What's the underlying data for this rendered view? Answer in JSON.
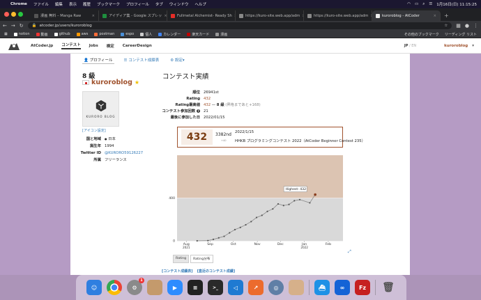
{
  "menubar": {
    "app": "Chrome",
    "items": [
      "ファイル",
      "編集",
      "表示",
      "履歴",
      "ブックマーク",
      "プロフィール",
      "タブ",
      "ウィンドウ",
      "ヘルプ"
    ],
    "datetime": "1月16日(日) 11:15:25"
  },
  "tabs": [
    {
      "title": "漫画 無料 – Manga Raw",
      "color": "#555"
    },
    {
      "title": "アイディア集 - Google スプレッ",
      "color": "#1e8e3e"
    },
    {
      "title": "Fullmetal Alchemist- Ready Sh",
      "color": "#e52d27"
    },
    {
      "title": "https://kuro-site.web.app/adm",
      "color": "#888"
    },
    {
      "title": "https://kuro-site.web.app/adm",
      "color": "#888"
    },
    {
      "title": "kuroroblog - AtCoder",
      "color": "#eee"
    }
  ],
  "address": {
    "url": "atcoder.jp/users/kuroroblog"
  },
  "bookmarks": [
    "notion",
    "動画",
    "github",
    "aws",
    "postman",
    "espo",
    "個人",
    "カレンダー",
    "楽天カード",
    "漫画"
  ],
  "bookmarks_right": [
    "その他のブックマーク",
    "リーディング リスト"
  ],
  "bookmark_colors": [
    "#fff",
    "#e33",
    "#fff",
    "#f90",
    "#ff6c37",
    "#4a90d9",
    "#ccc",
    "#4285f4",
    "#bf0000",
    "#999"
  ],
  "atcoder_nav": {
    "items": [
      "AtCoder.jp",
      "コンテスト",
      "Jobs",
      "検定",
      "CareerDesign"
    ],
    "lang_jp": "JP",
    "lang_en": "EN",
    "user": "kuroroblog"
  },
  "subnav": {
    "profile": "プロフィール",
    "history": "コンテスト成績表",
    "settings": "設定"
  },
  "user": {
    "kyu": "8 級",
    "name": "kuroroblog",
    "avatar_label": "KURORO BLOG",
    "icon_settings": "[アイコン設定]",
    "profile": [
      {
        "key": "国と地域",
        "value": "日本"
      },
      {
        "key": "誕生年",
        "value": "1994"
      },
      {
        "key": "Twitter ID",
        "value": "@KURORO59126227"
      },
      {
        "key": "所属",
        "value": "フリーランス"
      }
    ]
  },
  "contest": {
    "title": "コンテスト実績",
    "rank_label": "順位",
    "rank": "26941st",
    "rating_label": "Rating",
    "rating": "432",
    "max_label": "Rating最高値",
    "max": "432",
    "max_sep": " — ",
    "max_kyu": "8 級",
    "max_note": " (昇格まであと+168)",
    "count_label": "コンテスト参加回数",
    "count": "21",
    "last_label": "最後に参加した日",
    "last": "2022/01/15",
    "qmark": "?"
  },
  "latest": {
    "rating": "432",
    "rank": "3382nd",
    "delta": "+40",
    "date": "2022/1/15",
    "name": "HHKB プログラミングコンテスト 2022（AtCoder Beginner Contest 235）"
  },
  "buttons": {
    "rating": "Rating",
    "dist": "Rating分布"
  },
  "links": {
    "history": "[コンテスト成績表]",
    "recent": "[直近のコンテスト成績]"
  },
  "chart_data": {
    "type": "line",
    "x": [
      "2021-08-15",
      "2021-08-29",
      "2021-09-05",
      "2021-09-12",
      "2021-09-19",
      "2021-09-26",
      "2021-10-03",
      "2021-10-10",
      "2021-10-17",
      "2021-10-24",
      "2021-10-31",
      "2021-11-07",
      "2021-11-14",
      "2021-11-21",
      "2021-11-28",
      "2021-12-05",
      "2021-12-12",
      "2021-12-19",
      "2021-12-26",
      "2022-01-08",
      "2022-01-15"
    ],
    "y": [
      0,
      2,
      14,
      28,
      42,
      75,
      105,
      125,
      150,
      180,
      218,
      238,
      275,
      298,
      345,
      330,
      340,
      375,
      385,
      355,
      432
    ],
    "series": [
      {
        "values": [
          0,
          2,
          14,
          28,
          42,
          75,
          105,
          125,
          150,
          180,
          218,
          238,
          275,
          298,
          345,
          330,
          340,
          375,
          385,
          355,
          432
        ]
      }
    ],
    "xlabels": [
      {
        "text": "Aug",
        "date": "2021-08-01",
        "sub": "2021"
      },
      {
        "text": "Sep",
        "date": "2021-09-01"
      },
      {
        "text": "Oct",
        "date": "2021-10-01"
      },
      {
        "text": "Nov",
        "date": "2021-11-01"
      },
      {
        "text": "Dec",
        "date": "2021-12-01"
      },
      {
        "text": "Jan",
        "date": "2022-01-01",
        "sub": "2022"
      },
      {
        "text": "Feb",
        "date": "2022-02-01"
      }
    ],
    "yticks": [
      0,
      400
    ],
    "ylim": [
      0,
      800
    ],
    "xlim": [
      "2021-07-20",
      "2022-02-20"
    ],
    "bands": [
      {
        "from": 0,
        "to": 400,
        "color": "#d9d9d9"
      },
      {
        "from": 400,
        "to": 800,
        "color": "#dcc4b2"
      }
    ],
    "annotation": "Highest: 432",
    "colors": {
      "line": "#888888",
      "point": "#555555",
      "highest": "#8a3e1e"
    }
  },
  "dock": [
    {
      "name": "finder",
      "color": "#2f7fe0",
      "glyph": "☺"
    },
    {
      "name": "chrome",
      "color": "#e9e9e9",
      "glyph": ""
    },
    {
      "name": "system-preferences",
      "color": "#8a8a8a",
      "glyph": "⚙",
      "badge": "1"
    },
    {
      "name": "contacts",
      "color": "#c49a6c",
      "glyph": ""
    },
    {
      "name": "zoom",
      "color": "#2d8cff",
      "glyph": "▶"
    },
    {
      "name": "activity-monitor",
      "color": "#222",
      "glyph": "≡"
    },
    {
      "name": "terminal",
      "color": "#2a2a2a",
      "glyph": ">_"
    },
    {
      "name": "vscode",
      "color": "#1f7ad2",
      "glyph": "◁"
    },
    {
      "name": "git-tool",
      "color": "#ec6b2d",
      "glyph": "↗"
    },
    {
      "name": "quicktime",
      "color": "#5f7fa6",
      "glyph": "◎"
    },
    {
      "name": "preview",
      "color": "#d6b08a",
      "glyph": ""
    },
    {
      "name": "docker",
      "color": "#1d91e6",
      "glyph": "🐳"
    },
    {
      "name": "infinity",
      "color": "#1463d6",
      "glyph": "∞"
    },
    {
      "name": "filezilla",
      "color": "#c62020",
      "glyph": "Fz"
    },
    {
      "name": "trash",
      "color": "#888",
      "glyph": "🗑"
    }
  ]
}
